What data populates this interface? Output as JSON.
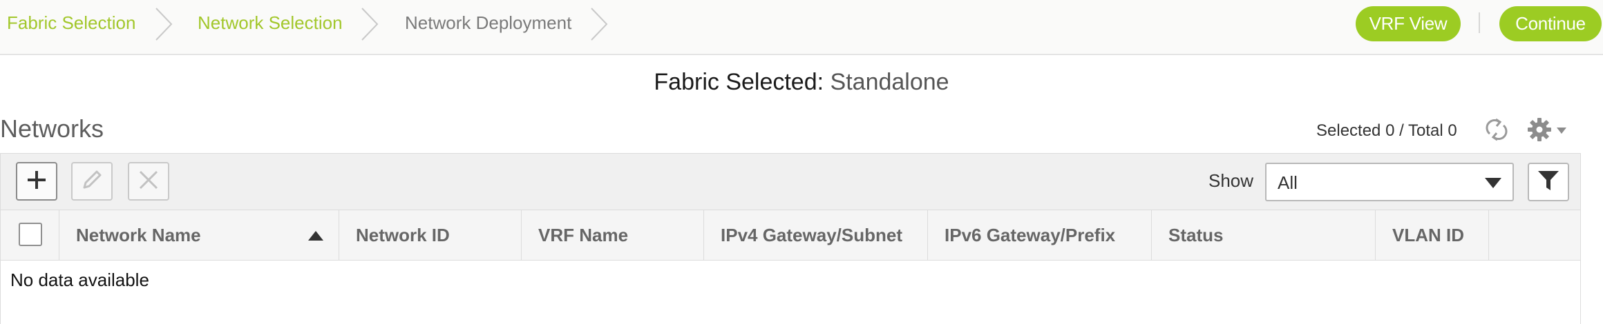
{
  "wizard": {
    "steps": [
      {
        "label": "Fabric Selection",
        "state": "done"
      },
      {
        "label": "Network Selection",
        "state": "done"
      },
      {
        "label": "Network Deployment",
        "state": "current"
      }
    ],
    "vrf_view_label": "VRF View",
    "continue_label": "Continue"
  },
  "fabric": {
    "label": "Fabric Selected:",
    "value": "Standalone"
  },
  "networks": {
    "title": "Networks",
    "count_text": "Selected 0 / Total 0",
    "icons": {
      "refresh": "refresh-icon",
      "settings": "gear-icon"
    }
  },
  "toolbar": {
    "icons": {
      "add": "plus-icon",
      "edit": "pencil-icon",
      "delete": "x-icon",
      "filter": "funnel-icon"
    },
    "show_label": "Show",
    "show_value": "All"
  },
  "table": {
    "columns": [
      "Network Name",
      "Network ID",
      "VRF Name",
      "IPv4 Gateway/Subnet",
      "IPv6 Gateway/Prefix",
      "Status",
      "VLAN ID"
    ],
    "sort": {
      "column": "Network Name",
      "direction": "ascending"
    },
    "empty_message": "No data available"
  },
  "colors": {
    "accent": "#9ccc23",
    "accent_text": "#a2c72b",
    "inactive_text": "#7a7a7a"
  }
}
